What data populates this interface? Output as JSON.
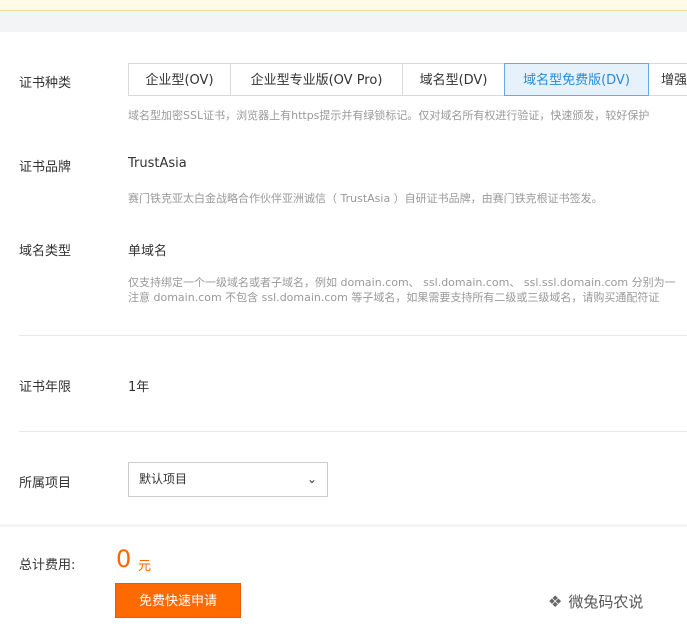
{
  "cert_type": {
    "label": "证书种类",
    "tabs": [
      "企业型(OV)",
      "企业型专业版(OV Pro)",
      "域名型(DV)",
      "域名型免费版(DV)",
      "增强"
    ],
    "selected": "域名型免费版(DV)",
    "hint": "域名型加密SSL证书，浏览器上有https提示并有绿锁标记。仅对域名所有权进行验证，快速颁发，较好保护"
  },
  "cert_brand": {
    "label": "证书品牌",
    "value": "TrustAsia",
    "hint": "赛门铁克亚太白金战略合作伙伴亚洲诚信（ TrustAsia ）自研证书品牌，由赛门铁克根证书签发。"
  },
  "domain_type": {
    "label": "域名类型",
    "value": "单域名",
    "hint_line1": "仅支持绑定一个一级域名或者子域名，例如 domain.com、 ssl.domain.com、 ssl.ssl.domain.com 分别为一",
    "hint_line2": "注意 domain.com 不包含 ssl.domain.com 等子域名，如果需要支持所有二级或三级域名，请购买通配符证"
  },
  "cert_years": {
    "label": "证书年限",
    "value": "1年"
  },
  "project": {
    "label": "所属项目",
    "selected": "默认项目"
  },
  "footer": {
    "total_label": "总计费用:",
    "amount": "0",
    "unit": "元",
    "apply_button": "免费快速申请"
  },
  "watermark": {
    "text": "微兔码农说",
    "icon": "wechat-icon"
  },
  "colors": {
    "accent_orange": "#ff6a00",
    "tab_active_border": "#66a9e6",
    "tab_active_bg": "#e6f2fb"
  }
}
